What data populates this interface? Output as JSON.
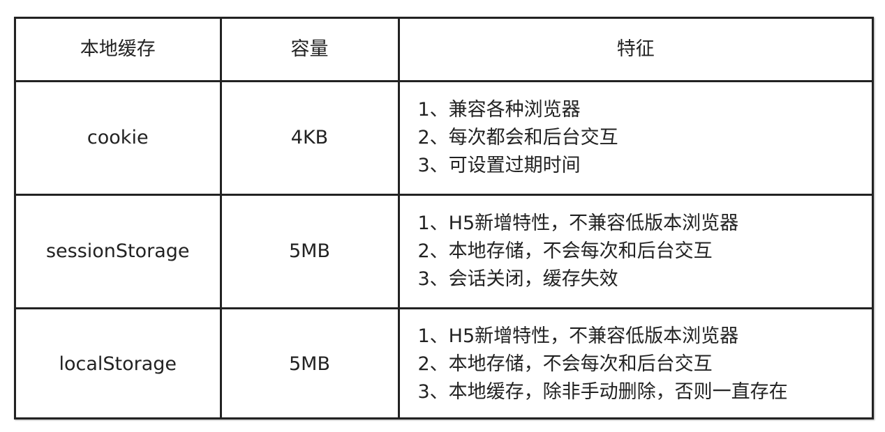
{
  "table": {
    "headers": {
      "name": "本地缓存",
      "size": "容量",
      "features": "特征"
    },
    "rows": [
      {
        "name": "cookie",
        "size": "4KB",
        "features": [
          "1、兼容各种浏览器",
          "2、每次都会和后台交互",
          "3、可设置过期时间"
        ]
      },
      {
        "name": "sessionStorage",
        "size": "5MB",
        "features": [
          "1、H5新增特性，不兼容低版本浏览器",
          "2、本地存储，不会每次和后台交互",
          "3、会话关闭，缓存失效"
        ]
      },
      {
        "name": "localStorage",
        "size": "5MB",
        "features": [
          "1、H5新增特性，不兼容低版本浏览器",
          "2、本地存储，不会每次和后台交互",
          "3、本地缓存，除非手动删除，否则一直存在"
        ]
      }
    ]
  }
}
